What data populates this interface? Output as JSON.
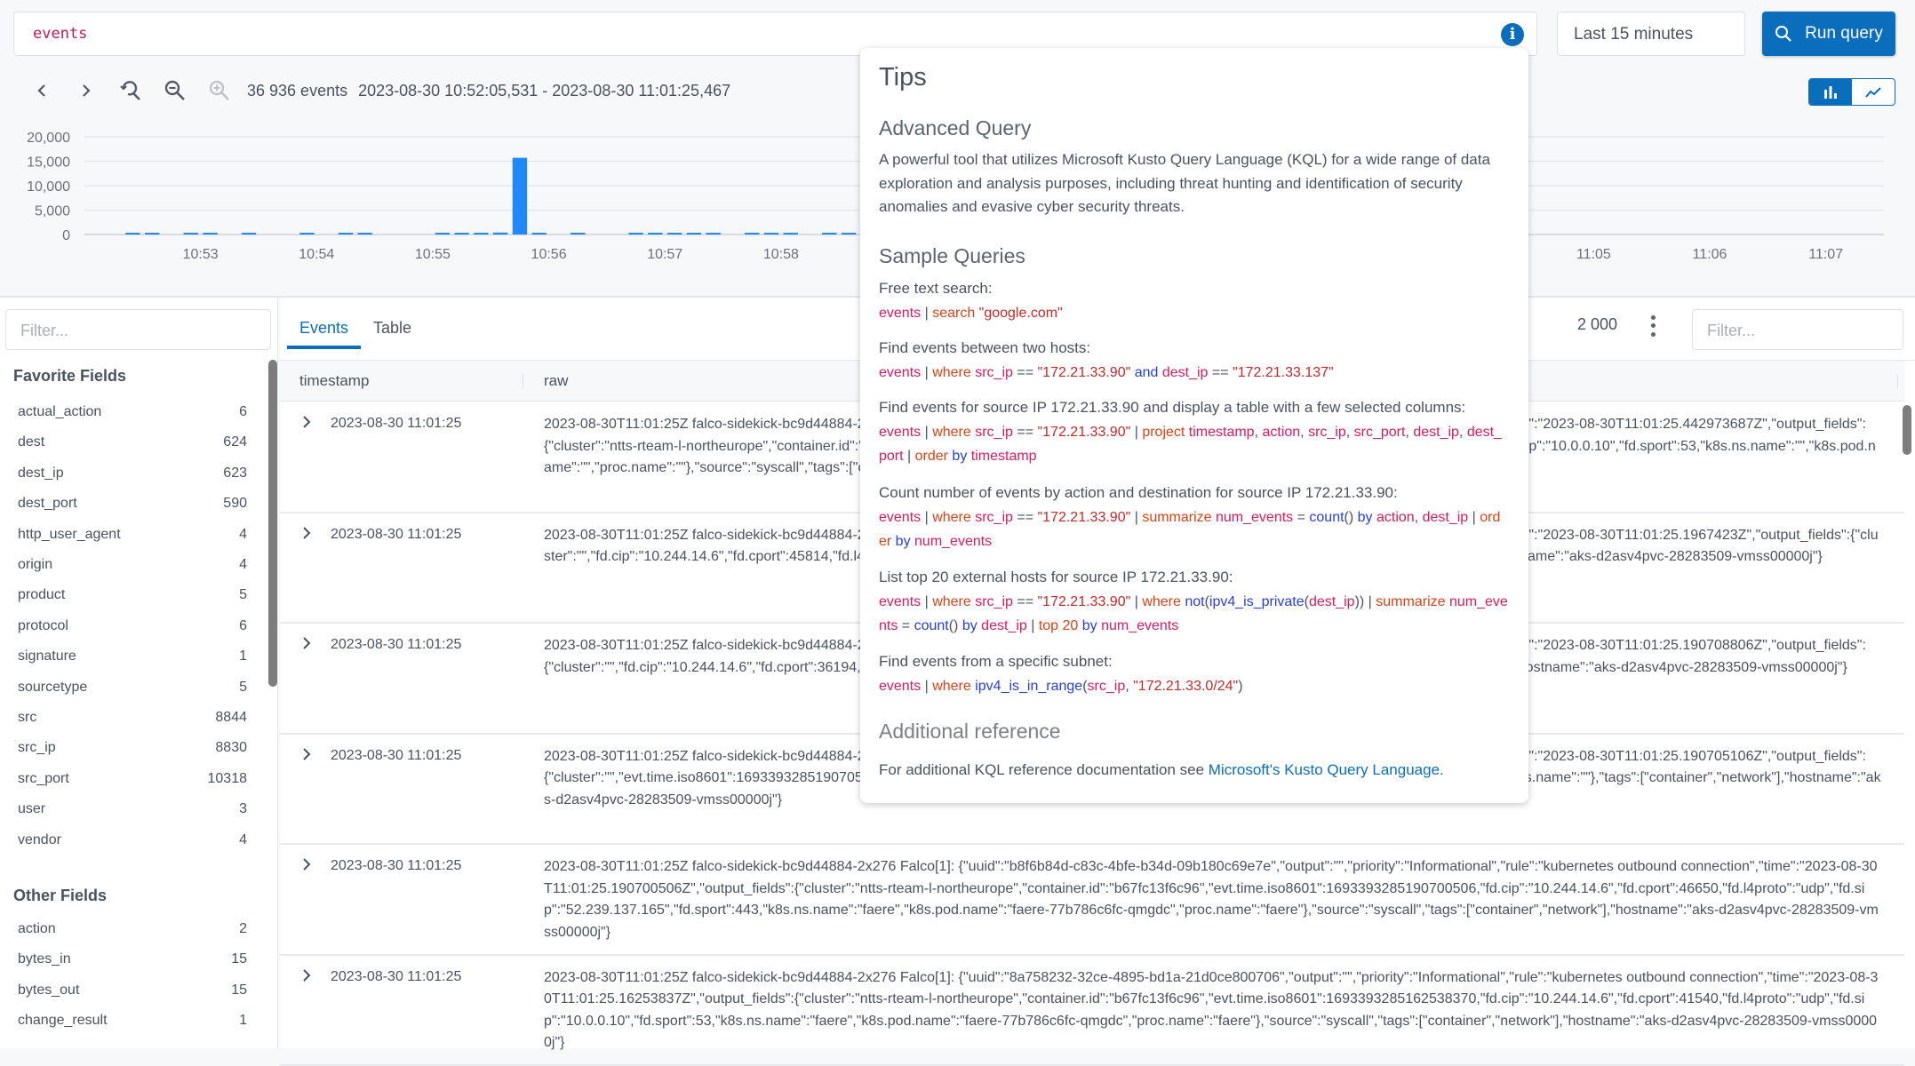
{
  "query": {
    "text": "events",
    "info_icon": "info-icon"
  },
  "time_picker": {
    "label": "Last 15 minutes"
  },
  "run_button": {
    "label": "Run query",
    "icon": "search-icon"
  },
  "toolbar": {
    "event_count": "36 936 events",
    "time_range": "2023-08-30 10:52:05,531 - 2023-08-30 11:01:25,467",
    "icons": [
      "chevron-left-icon",
      "chevron-right-icon",
      "zoom-reset-icon",
      "zoom-out-icon",
      "zoom-in-icon"
    ]
  },
  "chart_toggle": {
    "options": [
      "bar-chart",
      "line-chart"
    ],
    "selected": "bar-chart"
  },
  "colors": {
    "accent": "#0a6ebd",
    "bar": "#2088f7",
    "bar_light": "#a7cdf5"
  },
  "chart_data": {
    "type": "bar",
    "title": "",
    "xlabel": "",
    "ylabel": "",
    "ylim": [
      0,
      20000
    ],
    "yticks": [
      "0",
      "5,000",
      "10,000",
      "15,000",
      "20,000"
    ],
    "xticks": [
      "10:53",
      "10:54",
      "10:55",
      "10:56",
      "10:57",
      "10:58",
      "10:59",
      "11:00",
      "11:01",
      "11:02",
      "11:03",
      "11:04",
      "11:05",
      "11:06",
      "11:07"
    ],
    "x_range": [
      "10:52:00",
      "11:07:30"
    ],
    "grid": true,
    "bin_seconds": 10,
    "series": [
      {
        "name": "events",
        "points": [
          {
            "t": "10:52:25",
            "v": 60
          },
          {
            "t": "10:52:35",
            "v": 60
          },
          {
            "t": "10:52:55",
            "v": 40
          },
          {
            "t": "10:53:05",
            "v": 60
          },
          {
            "t": "10:53:25",
            "v": 60
          },
          {
            "t": "10:53:55",
            "v": 40
          },
          {
            "t": "10:54:15",
            "v": 40
          },
          {
            "t": "10:54:25",
            "v": 60
          },
          {
            "t": "10:55:05",
            "v": 40
          },
          {
            "t": "10:55:15",
            "v": 40
          },
          {
            "t": "10:55:25",
            "v": 40
          },
          {
            "t": "10:55:35",
            "v": 400
          },
          {
            "t": "10:55:45",
            "v": 15700
          },
          {
            "t": "10:55:55",
            "v": 200
          },
          {
            "t": "10:56:15",
            "v": 60
          },
          {
            "t": "10:56:45",
            "v": 40
          },
          {
            "t": "10:56:55",
            "v": 60
          },
          {
            "t": "10:57:05",
            "v": 60
          },
          {
            "t": "10:57:15",
            "v": 60
          },
          {
            "t": "10:57:25",
            "v": 60
          },
          {
            "t": "10:57:45",
            "v": 40
          },
          {
            "t": "10:57:55",
            "v": 60
          },
          {
            "t": "10:58:05",
            "v": 60
          },
          {
            "t": "10:58:25",
            "v": 40
          },
          {
            "t": "10:58:35",
            "v": 40
          },
          {
            "t": "10:58:45",
            "v": 60
          },
          {
            "t": "10:58:55",
            "v": 60
          },
          {
            "t": "10:59:15",
            "v": 60
          }
        ]
      }
    ]
  },
  "sidebar": {
    "filter_placeholder": "Filter...",
    "favorite_title": "Favorite Fields",
    "favorite_fields": [
      {
        "name": "actual_action",
        "count": "6"
      },
      {
        "name": "dest",
        "count": "624"
      },
      {
        "name": "dest_ip",
        "count": "623"
      },
      {
        "name": "dest_port",
        "count": "590"
      },
      {
        "name": "http_user_agent",
        "count": "4"
      },
      {
        "name": "origin",
        "count": "4"
      },
      {
        "name": "product",
        "count": "5"
      },
      {
        "name": "protocol",
        "count": "6"
      },
      {
        "name": "signature",
        "count": "1"
      },
      {
        "name": "sourcetype",
        "count": "5"
      },
      {
        "name": "src",
        "count": "8844"
      },
      {
        "name": "src_ip",
        "count": "8830"
      },
      {
        "name": "src_port",
        "count": "10318"
      },
      {
        "name": "user",
        "count": "3"
      },
      {
        "name": "vendor",
        "count": "4"
      }
    ],
    "other_title": "Other Fields",
    "other_fields": [
      {
        "name": "action",
        "count": "2"
      },
      {
        "name": "bytes_in",
        "count": "15"
      },
      {
        "name": "bytes_out",
        "count": "15"
      },
      {
        "name": "change_result",
        "count": "1"
      }
    ]
  },
  "results": {
    "tabs": [
      "Events",
      "Table"
    ],
    "active_tab": "Events",
    "count": "2 000",
    "filter_placeholder": "Filter...",
    "columns": [
      "timestamp",
      "raw"
    ],
    "rows": [
      {
        "timestamp": "2023-08-30 11:01:25",
        "raw": "2023-08-30T11:01:25Z falco-sidekick-bc9d44884-2x276 Falco[1]: {\"uuid\":\"\",\"output\":\"\",\"priority\":\"Informational\",\"rule\":\"kubernetes outbound connection\",\"time\":\"2023-08-30T11:01:25.442973687Z\",\"output_fields\":{\"cluster\":\"ntts-rteam-l-northeurope\",\"container.id\":\"\",\"evt.time.iso8601\":1693393285442973687,\"fd.cip\":\"10.244.16.6\",\"fd.cport\":41923,\"fd.l4proto\":\"udp\",\"fd.sip\":\"10.0.0.10\",\"fd.sport\":53,\"k8s.ns.name\":\"\",\"k8s.pod.name\":\"\",\"proc.name\":\"\"},\"source\":\"syscall\",\"tags\":[\"container\",\"network\"],\"hostname\":\"aks-d4asv4pvc-25179929-vmss00000o\"}"
      },
      {
        "timestamp": "2023-08-30 11:01:25",
        "raw": "2023-08-30T11:01:25Z falco-sidekick-bc9d44884-2x276 Falco[1]: {\"uuid\":\"\",\"output\":\"\",\"priority\":\"Informational\",\"rule\":\"kubernetes outbound connection\",\"time\":\"2023-08-30T11:01:25.1967423Z\",\"output_fields\":{\"cluster\":\"\",\"fd.cip\":\"10.244.14.6\",\"fd.cport\":45814,\"fd.l4proto\":\"tcp\",\"fd.sip\":\"52.239.137.165\",\"fd.sport\":443,\"k8s.ns.name\":\"\"},\"tags\":[\"container\",\"network\"],\"hostname\":\"aks-d2asv4pvc-28283509-vmss00000j\"}"
      },
      {
        "timestamp": "2023-08-30 11:01:25",
        "raw": "2023-08-30T11:01:25Z falco-sidekick-bc9d44884-2x276 Falco[1]: {\"uuid\":\"\",\"output\":\"\",\"priority\":\"Informational\",\"rule\":\"kubernetes outbound connection\",\"time\":\"2023-08-30T11:01:25.190708806Z\",\"output_fields\":{\"cluster\":\"\",\"fd.cip\":\"10.244.14.6\",\"fd.cport\":36194,\"fd.l4proto\":\"udp\",\"fd.sip\":\"52.239.137.37\",\"fd.sport\":443,\"k8s.ns.name\":\"\"},\"tags\":[\"container\",\"network\"],\"hostname\":\"aks-d2asv4pvc-28283509-vmss00000j\"}"
      },
      {
        "timestamp": "2023-08-30 11:01:25",
        "raw": "2023-08-30T11:01:25Z falco-sidekick-bc9d44884-2x276 Falco[1]: {\"uuid\":\"\",\"output\":\"\",\"priority\":\"Informational\",\"rule\":\"kubernetes outbound connection\",\"time\":\"2023-08-30T11:01:25.190705106Z\",\"output_fields\":{\"cluster\":\"\",\"evt.time.iso8601\":1693393285190705106,\"fd.cip\":\"10.244.14.6\",\"fd.cport\":58026,\"fd.l4proto\":\"udp\",\"fd.sip\":\"52.245.40.101\",\"fd.sport\":443,\"k8s.ns.name\":\"\"},\"tags\":[\"container\",\"network\"],\"hostname\":\"aks-d2asv4pvc-28283509-vmss00000j\"}"
      },
      {
        "timestamp": "2023-08-30 11:01:25",
        "raw": "2023-08-30T11:01:25Z falco-sidekick-bc9d44884-2x276 Falco[1]: {\"uuid\":\"b8f6b84d-c83c-4bfe-b34d-09b180c69e7e\",\"output\":\"\",\"priority\":\"Informational\",\"rule\":\"kubernetes outbound connection\",\"time\":\"2023-08-30T11:01:25.190700506Z\",\"output_fields\":{\"cluster\":\"ntts-rteam-l-northeurope\",\"container.id\":\"b67fc13f6c96\",\"evt.time.iso8601\":1693393285190700506,\"fd.cip\":\"10.244.14.6\",\"fd.cport\":46650,\"fd.l4proto\":\"udp\",\"fd.sip\":\"52.239.137.165\",\"fd.sport\":443,\"k8s.ns.name\":\"faere\",\"k8s.pod.name\":\"faere-77b786c6fc-qmgdc\",\"proc.name\":\"faere\"},\"source\":\"syscall\",\"tags\":[\"container\",\"network\"],\"hostname\":\"aks-d2asv4pvc-28283509-vmss00000j\"}"
      },
      {
        "timestamp": "2023-08-30 11:01:25",
        "raw": "2023-08-30T11:01:25Z falco-sidekick-bc9d44884-2x276 Falco[1]: {\"uuid\":\"8a758232-32ce-4895-bd1a-21d0ce800706\",\"output\":\"\",\"priority\":\"Informational\",\"rule\":\"kubernetes outbound connection\",\"time\":\"2023-08-30T11:01:25.16253837Z\",\"output_fields\":{\"cluster\":\"ntts-rteam-l-northeurope\",\"container.id\":\"b67fc13f6c96\",\"evt.time.iso8601\":1693393285162538370,\"fd.cip\":\"10.244.14.6\",\"fd.cport\":41540,\"fd.l4proto\":\"udp\",\"fd.sip\":\"10.0.0.10\",\"fd.sport\":53,\"k8s.ns.name\":\"faere\",\"k8s.pod.name\":\"faere-77b786c6fc-qmgdc\",\"proc.name\":\"faere\"},\"source\":\"syscall\",\"tags\":[\"container\",\"network\"],\"hostname\":\"aks-d2asv4pvc-28283509-vmss00000j\"}"
      }
    ]
  },
  "tips": {
    "title": "Tips",
    "advanced_heading": "Advanced Query",
    "advanced_text": "A powerful tool that utilizes Microsoft Kusto Query Language (KQL) for a wide range of data exploration and analysis purposes, including threat hunting and identification of security anomalies and evasive cyber security threats.",
    "samples_heading": "Sample Queries",
    "samples": [
      {
        "label": "Free text search:",
        "tokens": [
          [
            "tbl",
            "events"
          ],
          [
            "pl",
            " | "
          ],
          [
            "op",
            "search "
          ],
          [
            "str",
            "\"google.com\""
          ]
        ]
      },
      {
        "label": "Find events between two hosts:",
        "tokens": [
          [
            "tbl",
            "events"
          ],
          [
            "pl",
            " | "
          ],
          [
            "op",
            "where "
          ],
          [
            "tbl",
            "src_ip"
          ],
          [
            "pl",
            " == "
          ],
          [
            "str",
            "\"172.21.33.90\""
          ],
          [
            "fn",
            " and "
          ],
          [
            "tbl",
            "dest_ip"
          ],
          [
            "pl",
            " == "
          ],
          [
            "str",
            "\"172.21.33.137\""
          ]
        ]
      },
      {
        "label": "Find events for source IP 172.21.33.90 and display a table with a few selected columns:",
        "tokens": [
          [
            "tbl",
            "events"
          ],
          [
            "pl",
            " | "
          ],
          [
            "op",
            "where "
          ],
          [
            "tbl",
            "src_ip"
          ],
          [
            "pl",
            " == "
          ],
          [
            "str",
            "\"172.21.33.90\""
          ],
          [
            "pl",
            " | "
          ],
          [
            "op",
            "project "
          ],
          [
            "tbl",
            "timestamp"
          ],
          [
            "pl",
            ", "
          ],
          [
            "tbl",
            "action"
          ],
          [
            "pl",
            ", "
          ],
          [
            "tbl",
            "src_ip"
          ],
          [
            "pl",
            ", "
          ],
          [
            "tbl",
            "src_port"
          ],
          [
            "pl",
            ", "
          ],
          [
            "tbl",
            "dest_ip"
          ],
          [
            "pl",
            ", "
          ],
          [
            "tbl",
            "dest_port"
          ],
          [
            "pl",
            " | "
          ],
          [
            "op",
            "order "
          ],
          [
            "fn",
            "by "
          ],
          [
            "tbl",
            "timestamp"
          ]
        ]
      },
      {
        "label": "Count number of events by action and destination for source IP 172.21.33.90:",
        "tokens": [
          [
            "tbl",
            "events"
          ],
          [
            "pl",
            " | "
          ],
          [
            "op",
            "where "
          ],
          [
            "tbl",
            "src_ip"
          ],
          [
            "pl",
            " == "
          ],
          [
            "str",
            "\"172.21.33.90\""
          ],
          [
            "pl",
            " | "
          ],
          [
            "op",
            "summarize "
          ],
          [
            "tbl",
            "num_events"
          ],
          [
            "pl",
            " = "
          ],
          [
            "fn",
            "count"
          ],
          [
            "pl",
            "() "
          ],
          [
            "fn",
            "by "
          ],
          [
            "tbl",
            "action"
          ],
          [
            "pl",
            ", "
          ],
          [
            "tbl",
            "dest_ip"
          ],
          [
            "pl",
            " | "
          ],
          [
            "op",
            "order "
          ],
          [
            "fn",
            "by "
          ],
          [
            "tbl",
            "num_events"
          ]
        ]
      },
      {
        "label": "List top 20 external hosts for source IP 172.21.33.90:",
        "tokens": [
          [
            "tbl",
            "events"
          ],
          [
            "pl",
            " | "
          ],
          [
            "op",
            "where "
          ],
          [
            "tbl",
            "src_ip"
          ],
          [
            "pl",
            " == "
          ],
          [
            "str",
            "\"172.21.33.90\""
          ],
          [
            "pl",
            " | "
          ],
          [
            "op",
            "where "
          ],
          [
            "fn",
            "not"
          ],
          [
            "pl",
            "("
          ],
          [
            "fn",
            "ipv4_is_private"
          ],
          [
            "pl",
            "("
          ],
          [
            "tbl",
            "dest_ip"
          ],
          [
            "pl",
            "))"
          ],
          [
            "pl",
            " | "
          ],
          [
            "op",
            "summarize "
          ],
          [
            "tbl",
            "num_events"
          ],
          [
            "pl",
            " = "
          ],
          [
            "fn",
            "count"
          ],
          [
            "pl",
            "() "
          ],
          [
            "fn",
            "by "
          ],
          [
            "tbl",
            "dest_ip"
          ],
          [
            "pl",
            " | "
          ],
          [
            "op",
            "top 20 "
          ],
          [
            "fn",
            "by "
          ],
          [
            "tbl",
            "num_events"
          ]
        ]
      },
      {
        "label": "Find events from a specific subnet:",
        "tokens": [
          [
            "tbl",
            "events"
          ],
          [
            "pl",
            " | "
          ],
          [
            "op",
            "where "
          ],
          [
            "fn",
            "ipv4_is_in_range"
          ],
          [
            "pl",
            "("
          ],
          [
            "tbl",
            "src_ip"
          ],
          [
            "pl",
            ", "
          ],
          [
            "str",
            "\"172.21.33.0/24\""
          ],
          [
            "pl",
            ")"
          ]
        ]
      }
    ],
    "reference_heading": "Additional reference",
    "reference_text": "For additional KQL reference documentation see ",
    "reference_link": "Microsoft's Kusto Query Language."
  }
}
